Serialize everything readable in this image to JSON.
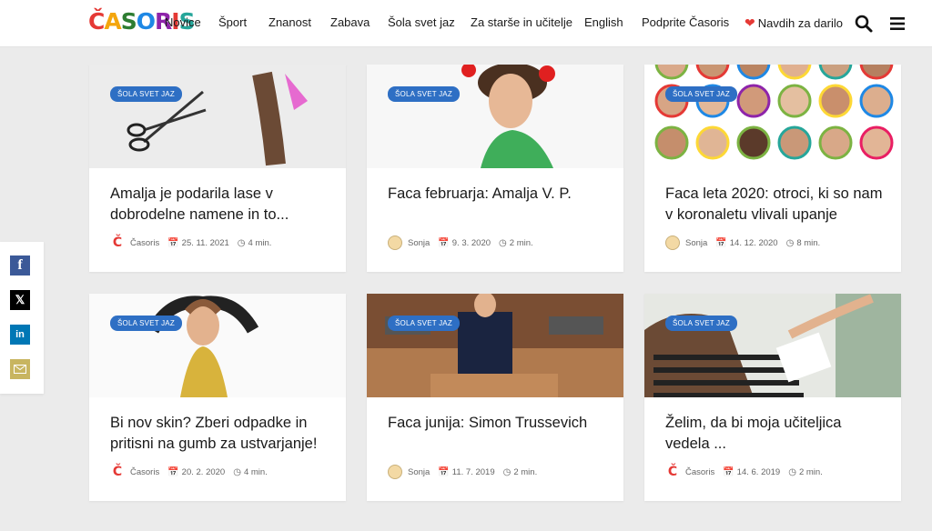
{
  "header": {
    "logo": [
      "Č",
      "A",
      "S",
      "O",
      "R",
      "I",
      "S"
    ],
    "nav": [
      "Novice",
      "Šport",
      "Znanost",
      "Zabava",
      "Šola svet jaz",
      "Za starše in učitelje",
      "English",
      "Podprite Časoris",
      "Navdih za darilo"
    ],
    "icons": [
      "search-icon",
      "menu-icon"
    ]
  },
  "social": [
    "facebook-icon",
    "x-icon",
    "linkedin-icon",
    "email-icon"
  ],
  "cards": [
    {
      "category": "ŠOLA SVET JAZ",
      "title": "Amalja je podarila lase v dobrodelne namene in to...",
      "author": "Časoris",
      "date": "25. 11. 2021",
      "read": "4 min."
    },
    {
      "category": "ŠOLA SVET JAZ",
      "title": "Faca februarja: Amalja V. P.",
      "author": "Sonja",
      "date": "9. 3. 2020",
      "read": "2 min."
    },
    {
      "category": "ŠOLA SVET JAZ",
      "title": "Faca leta 2020: otroci, ki so nam v koronaletu vlivali upanje",
      "author": "Sonja",
      "date": "14. 12. 2020",
      "read": "8 min."
    },
    {
      "category": "ŠOLA SVET JAZ",
      "title": "Bi nov skin? Zberi odpadke in pritisni na gumb za ustvarjanje!",
      "author": "Časoris",
      "date": "20. 2. 2020",
      "read": "4 min."
    },
    {
      "category": "ŠOLA SVET JAZ",
      "title": "Faca junija: Simon Trussevich",
      "author": "Sonja",
      "date": "11. 7. 2019",
      "read": "2 min."
    },
    {
      "category": "ŠOLA SVET JAZ",
      "title": "Želim, da bi moja učiteljica vedela ...",
      "author": "Časoris",
      "date": "14. 6. 2019",
      "read": "2 min."
    }
  ]
}
